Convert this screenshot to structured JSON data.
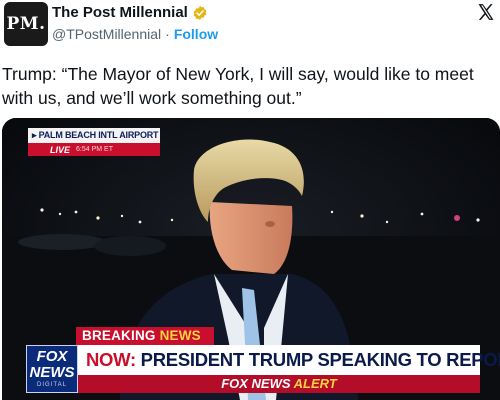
{
  "account": {
    "avatar_text": "PM.",
    "display_name": "The Post Millennial",
    "handle": "@TPostMillennial",
    "separator": "·",
    "follow_label": "Follow",
    "verified_color": "#e2b719"
  },
  "tweet": {
    "text": "Trump: “The Mayor of New York, I will say, would like to meet with us, and we’ll work something out.”"
  },
  "broadcast": {
    "location": "▸ PALM BEACH INTL AIRPORT",
    "live_label": "LIVE",
    "time": "6:54 PM ET",
    "breaking_prefix": "BREAKING ",
    "breaking_suffix": "NEWS",
    "network_logo_top": "FOX",
    "network_logo_bottom": "NEWS",
    "network_logo_sub": "DIGITAL",
    "headline_prefix": "NOW:",
    "headline_rest": " PRESIDENT TRUMP SPEAKING TO REPORTERS",
    "alert_prefix": "FOX NEWS ",
    "alert_suffix": "ALERT"
  },
  "colors": {
    "accent_link": "#1d9bf0",
    "fox_red": "#c8102e",
    "fox_blue": "#0a2a7a",
    "alert_yellow": "#ffd23f"
  }
}
